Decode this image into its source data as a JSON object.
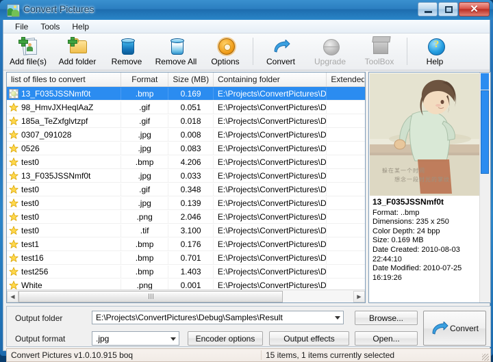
{
  "window": {
    "title": "Convert Pictures",
    "icon": "picture-icon",
    "controls": {
      "minimize": "–",
      "maximize": "□",
      "close": "✕"
    }
  },
  "menu": {
    "items": [
      "File",
      "Tools",
      "Help"
    ]
  },
  "toolbar": {
    "buttons": [
      {
        "label": "Add file(s)",
        "icon": "add-file-icon",
        "disabled": false
      },
      {
        "label": "Add folder",
        "icon": "add-folder-icon",
        "disabled": false
      },
      {
        "label": "Remove",
        "icon": "trash-blue-icon",
        "disabled": false
      },
      {
        "label": "Remove All",
        "icon": "trash-empty-icon",
        "disabled": false
      },
      {
        "label": "Options",
        "icon": "gear-icon",
        "disabled": false
      },
      {
        "label": "Convert",
        "icon": "convert-arrow-icon",
        "disabled": false
      },
      {
        "label": "Upgrade",
        "icon": "globe-icon",
        "disabled": true
      },
      {
        "label": "ToolBox",
        "icon": "toolbox-icon",
        "disabled": true
      },
      {
        "label": "Help",
        "icon": "help-question-icon",
        "disabled": false
      }
    ]
  },
  "file_list": {
    "columns": [
      "list of files to convert",
      "Format",
      "Size (MB)",
      "Containing folder",
      "Extended"
    ],
    "rows": [
      {
        "name": "13_F035JSSNmf0t",
        "format": ".bmp",
        "size": "0.169",
        "folder": "E:\\Projects\\ConvertPictures\\Debug\\Samples",
        "extended": "",
        "selected": true,
        "icon": "image-thumb-icon"
      },
      {
        "name": "98_HmvJXHeqlAaZ",
        "format": ".gif",
        "size": "0.051",
        "folder": "E:\\Projects\\ConvertPictures\\Debug\\Samples",
        "extended": "",
        "selected": false,
        "icon": "star-icon"
      },
      {
        "name": "185a_TeZxfglvtzpf",
        "format": ".gif",
        "size": "0.018",
        "folder": "E:\\Projects\\ConvertPictures\\Debug\\Samples",
        "extended": "",
        "selected": false,
        "icon": "star-icon"
      },
      {
        "name": "0307_091028",
        "format": ".jpg",
        "size": "0.008",
        "folder": "E:\\Projects\\ConvertPictures\\Debug\\Samples",
        "extended": "",
        "selected": false,
        "icon": "star-icon"
      },
      {
        "name": "0526",
        "format": ".jpg",
        "size": "0.083",
        "folder": "E:\\Projects\\ConvertPictures\\Debug\\Samples",
        "extended": "",
        "selected": false,
        "icon": "star-icon"
      },
      {
        "name": "test0",
        "format": ".bmp",
        "size": "4.206",
        "folder": "E:\\Projects\\ConvertPictures\\Debug\\Samples",
        "extended": "",
        "selected": false,
        "icon": "star-icon"
      },
      {
        "name": "13_F035JSSNmf0t",
        "format": ".jpg",
        "size": "0.033",
        "folder": "E:\\Projects\\ConvertPictures\\Debug\\Samples",
        "extended": "",
        "selected": false,
        "icon": "star-icon"
      },
      {
        "name": "test0",
        "format": ".gif",
        "size": "0.348",
        "folder": "E:\\Projects\\ConvertPictures\\Debug\\Samples",
        "extended": "",
        "selected": false,
        "icon": "star-icon"
      },
      {
        "name": "test0",
        "format": ".jpg",
        "size": "0.139",
        "folder": "E:\\Projects\\ConvertPictures\\Debug\\Samples",
        "extended": "",
        "selected": false,
        "icon": "star-icon"
      },
      {
        "name": "test0",
        "format": ".png",
        "size": "2.046",
        "folder": "E:\\Projects\\ConvertPictures\\Debug\\Samples",
        "extended": "",
        "selected": false,
        "icon": "star-icon"
      },
      {
        "name": "test0",
        "format": ".tif",
        "size": "3.100",
        "folder": "E:\\Projects\\ConvertPictures\\Debug\\Samples",
        "extended": "",
        "selected": false,
        "icon": "star-icon"
      },
      {
        "name": "test1",
        "format": ".bmp",
        "size": "0.176",
        "folder": "E:\\Projects\\ConvertPictures\\Debug\\Samples",
        "extended": "",
        "selected": false,
        "icon": "star-icon"
      },
      {
        "name": "test16",
        "format": ".bmp",
        "size": "0.701",
        "folder": "E:\\Projects\\ConvertPictures\\Debug\\Samples",
        "extended": "",
        "selected": false,
        "icon": "star-icon"
      },
      {
        "name": "test256",
        "format": ".bmp",
        "size": "1.403",
        "folder": "E:\\Projects\\ConvertPictures\\Debug\\Samples",
        "extended": "",
        "selected": false,
        "icon": "star-icon"
      },
      {
        "name": "White",
        "format": ".png",
        "size": "0.001",
        "folder": "E:\\Projects\\ConvertPictures\\Debug\\Samples",
        "extended": "",
        "selected": false,
        "icon": "star-icon"
      }
    ]
  },
  "preview": {
    "image_caption_line1": "躲在某一个时间",
    "image_caption_line2": "想念一段时光的掌纹",
    "title": "13_F035JSSNmf0t",
    "format": "Format: ..bmp",
    "dimensions": "Dimensions: 235 x 250",
    "color_depth": "Color Depth: 24 bpp",
    "size": "Size: 0.169 MB",
    "date_created": "Date Created: 2010-08-03",
    "date_created_time": "22:44:10",
    "date_modified": "Date Modified: 2010-07-25",
    "date_modified_time": "16:19:26"
  },
  "output": {
    "folder_label": "Output folder",
    "folder_value": "E:\\Projects\\ConvertPictures\\Debug\\Samples\\Result",
    "format_label": "Output format",
    "format_value": ".jpg",
    "browse_label": "Browse...",
    "encoder_label": "Encoder options",
    "effects_label": "Output effects",
    "open_label": "Open...",
    "convert_label": "Convert"
  },
  "status": {
    "version": "Convert Pictures v1.0.10.915 boq",
    "items": "15 items, 1 items currently selected"
  },
  "colors": {
    "selection_blue": "#2b8cf0",
    "title_blue": "#2b7ec0",
    "close_red": "#bc2f25",
    "folder_yellow": "#f0bf4d"
  }
}
